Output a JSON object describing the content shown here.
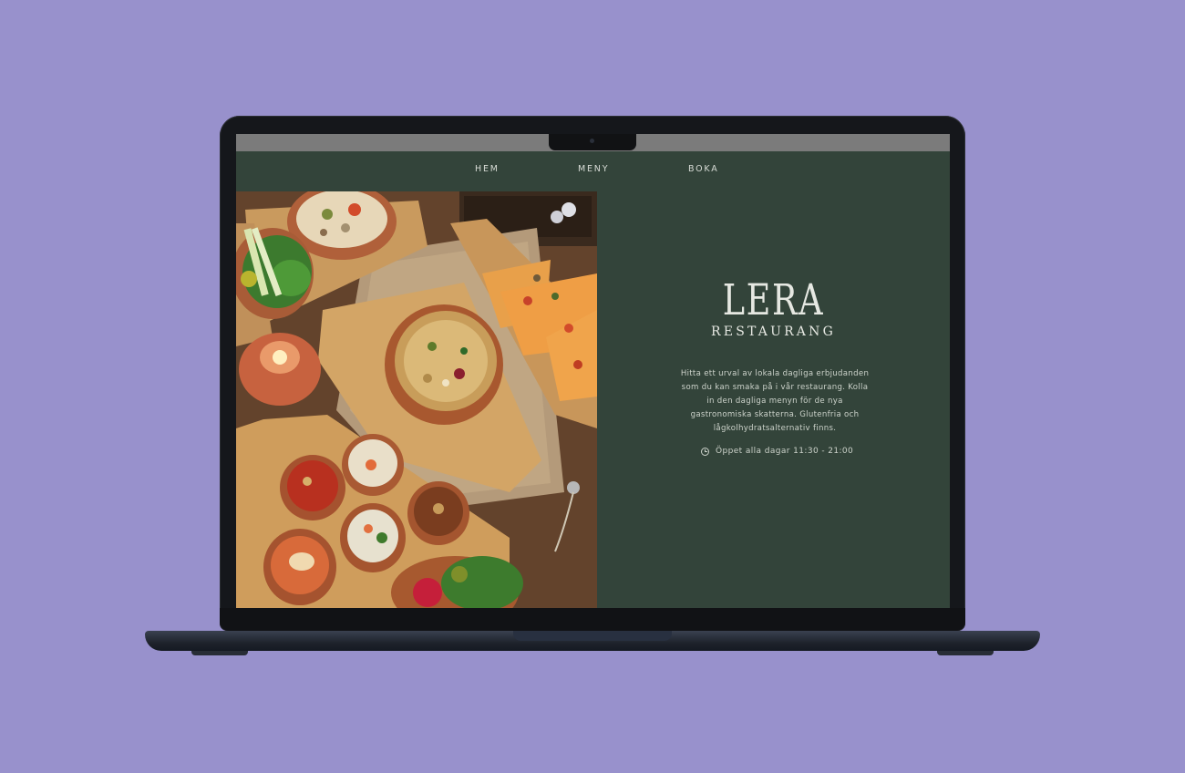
{
  "nav": {
    "items": [
      {
        "label": "HEM"
      },
      {
        "label": "MENY"
      },
      {
        "label": "BOKA"
      }
    ]
  },
  "hero": {
    "photo_alt": "food-spread-photo"
  },
  "brand": {
    "name": "LERA",
    "subtitle": "RESTAURANG"
  },
  "intro": {
    "text": "Hitta ett urval av lokala dagliga erbjudanden som du kan smaka på i vår restaurang. Kolla in den dagliga menyn för de nya gastronomiska skatterna. Glutenfria och lågkolhydratsalternativ finns."
  },
  "hours": {
    "icon": "clock-icon",
    "text": "Öppet alla dagar 11:30 - 21:00"
  },
  "colors": {
    "background": "#9891cc",
    "site_green": "#33443a",
    "text_light": "#e6e8e2"
  }
}
